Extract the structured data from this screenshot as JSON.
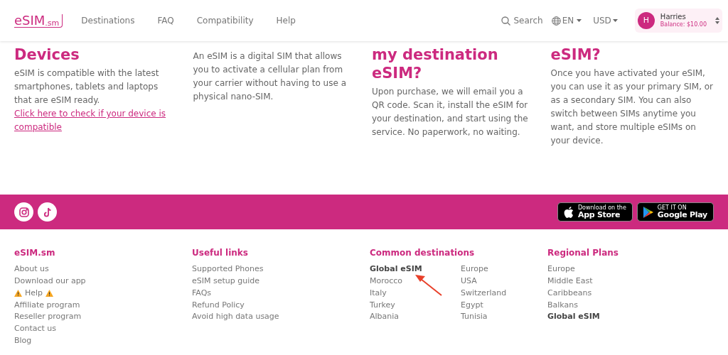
{
  "header": {
    "logo": {
      "main": "eSIM",
      "suffix": ".sm"
    },
    "nav": [
      "Destinations",
      "FAQ",
      "Compatibility",
      "Help"
    ],
    "search": "Search",
    "language": "EN",
    "currency": "USD",
    "user": {
      "initial": "H",
      "name": "Harries",
      "balance": "Balance: $10.00"
    }
  },
  "features": [
    {
      "heading": "Devices",
      "text": "eSIM is compatible with the latest smartphones, tablets and laptops that are eSIM ready. ",
      "link": "Click here to check if your device is compatible"
    },
    {
      "text": "An eSIM is a digital SIM that allows you to activate a cellular plan from your carrier without having to use a physical nano-SIM."
    },
    {
      "heading": "my destination eSIM?",
      "text": "Upon purchase, we will email you a QR code. Scan it, install the eSIM for your destination, and start using the service. No paperwork, no waiting."
    },
    {
      "heading": "eSIM?",
      "text": "Once you have activated your eSIM, you can use it as your primary SIM, or as a secondary SIM. You can also switch between SIMs anytime you want, and store multiple eSIMs on your device."
    }
  ],
  "social": [
    {
      "kind": "instagram"
    },
    {
      "kind": "tiktok"
    }
  ],
  "stores": [
    {
      "kind": "apple",
      "small": "Download on the",
      "big": "App Store"
    },
    {
      "kind": "google",
      "small": "GET IT ON",
      "big": "Google Play"
    }
  ],
  "footer": [
    {
      "title": "eSIM.sm",
      "link_columns": [
        [
          {
            "label": "About us",
            "bold": false,
            "warning": false
          },
          {
            "label": "Download our app",
            "bold": false,
            "warning": false
          },
          {
            "label": "Help",
            "bold": false,
            "warning": true
          },
          {
            "label": "Affiliate program",
            "bold": false,
            "warning": false
          },
          {
            "label": "Reseller program",
            "bold": false,
            "warning": false
          },
          {
            "label": "Contact us",
            "bold": false,
            "warning": false
          },
          {
            "label": "Blog",
            "bold": false,
            "warning": false
          }
        ]
      ]
    },
    {
      "title": "Useful links",
      "link_columns": [
        [
          {
            "label": "Supported Phones",
            "bold": false,
            "warning": false
          },
          {
            "label": "eSIM setup guide",
            "bold": false,
            "warning": false
          },
          {
            "label": "FAQs",
            "bold": false,
            "warning": false
          },
          {
            "label": "Refund Policy",
            "bold": false,
            "warning": false
          },
          {
            "label": "Avoid high data usage",
            "bold": false,
            "warning": false
          }
        ]
      ]
    },
    {
      "title": "Common destinations",
      "annotated": true,
      "link_columns": [
        [
          {
            "label": "Global eSIM",
            "bold": true,
            "warning": false
          },
          {
            "label": "Morocco",
            "bold": false,
            "warning": false
          },
          {
            "label": "Italy",
            "bold": false,
            "warning": false
          },
          {
            "label": "Turkey",
            "bold": false,
            "warning": false
          },
          {
            "label": "Albania",
            "bold": false,
            "warning": false
          }
        ],
        [
          {
            "label": "Europe",
            "bold": false,
            "warning": false
          },
          {
            "label": "USA",
            "bold": false,
            "warning": false
          },
          {
            "label": "Switzerland",
            "bold": false,
            "warning": false
          },
          {
            "label": "Egypt",
            "bold": false,
            "warning": false
          },
          {
            "label": "Tunisia",
            "bold": false,
            "warning": false
          }
        ]
      ]
    },
    {
      "title": "Regional Plans",
      "link_columns": [
        [
          {
            "label": "Europe",
            "bold": false,
            "warning": false
          },
          {
            "label": "Middle East",
            "bold": false,
            "warning": false
          },
          {
            "label": "Caribbeans",
            "bold": false,
            "warning": false
          },
          {
            "label": "Balkans",
            "bold": false,
            "warning": false
          },
          {
            "label": "Global eSIM",
            "bold": true,
            "warning": false
          }
        ]
      ]
    }
  ]
}
